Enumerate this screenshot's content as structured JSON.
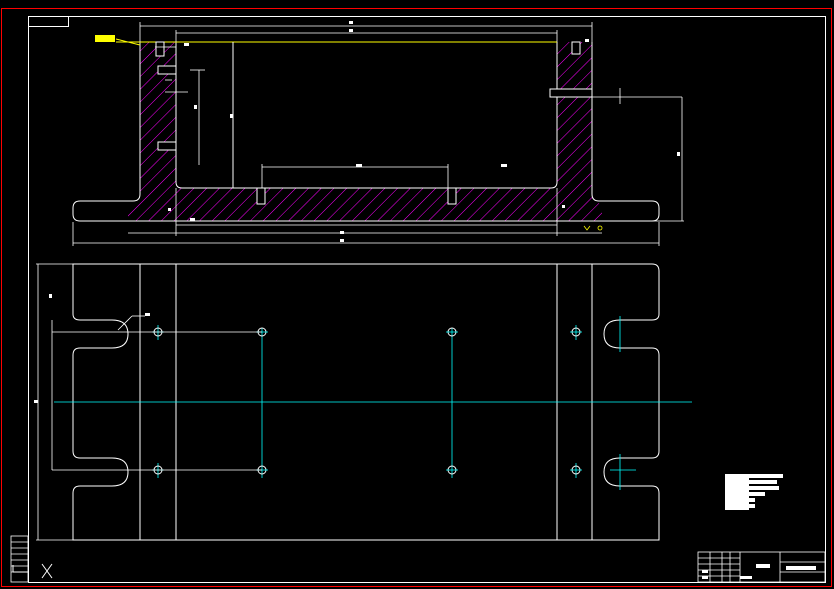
{
  "colors": {
    "background": "#000000",
    "frame": "#ff0000",
    "outline": "#ffffff",
    "hatch": "#ff00ff",
    "centerline": "#00ffff",
    "leader": "#ffff00",
    "hole": "#00ff00"
  },
  "icons": {
    "ucs": "ucs-axis-icon"
  },
  "drawing": {
    "section_view": "section-view",
    "plan_view": "plan-view",
    "title_block": "title-block",
    "tech_notes": "technical-notes-block"
  }
}
